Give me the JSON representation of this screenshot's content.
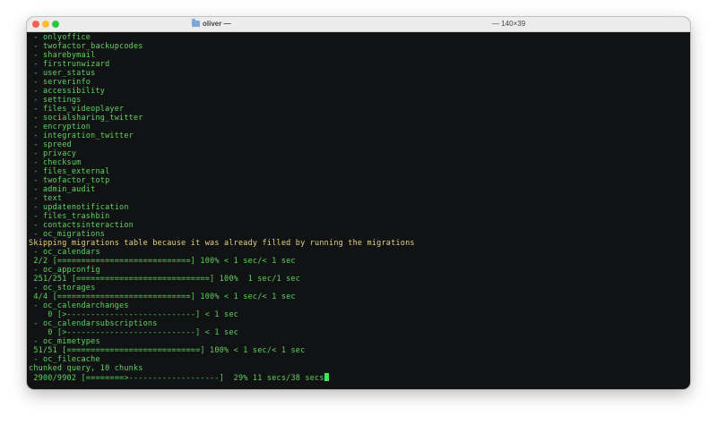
{
  "window": {
    "title_user": "oliver —",
    "title_size": "— 140×39",
    "colors": {
      "close": "#ff5f57",
      "minimize": "#febc2e",
      "zoom": "#28c840",
      "terminal_bg": "#111214",
      "text_green": "#5fd25f",
      "text_yellow": "#e6d27a",
      "cursor": "#41e35a"
    }
  },
  "terminal": {
    "lines": [
      {
        "text": " - onlyoffice",
        "color": "green"
      },
      {
        "text": " - twofactor_backupcodes",
        "color": "green"
      },
      {
        "text": " - sharebymail",
        "color": "green"
      },
      {
        "text": " - firstrunwizard",
        "color": "green"
      },
      {
        "text": " - user_status",
        "color": "green"
      },
      {
        "text": " - serverinfo",
        "color": "green"
      },
      {
        "text": " - accessibility",
        "color": "green"
      },
      {
        "text": " - settings",
        "color": "green"
      },
      {
        "text": " - files_videoplayer",
        "color": "green"
      },
      {
        "text": " - socialsharing_twitter",
        "color": "green"
      },
      {
        "text": " - encryption",
        "color": "green"
      },
      {
        "text": " - integration_twitter",
        "color": "green"
      },
      {
        "text": " - spreed",
        "color": "green"
      },
      {
        "text": " - privacy",
        "color": "green"
      },
      {
        "text": " - checksum",
        "color": "green"
      },
      {
        "text": " - files_external",
        "color": "green"
      },
      {
        "text": " - twofactor_totp",
        "color": "green"
      },
      {
        "text": " - admin_audit",
        "color": "green"
      },
      {
        "text": " - text",
        "color": "green"
      },
      {
        "text": " - updatenotification",
        "color": "green"
      },
      {
        "text": " - files_trashbin",
        "color": "green"
      },
      {
        "text": " - contactsinteraction",
        "color": "green"
      },
      {
        "text": " - oc_migrations",
        "color": "green"
      },
      {
        "text": "Skipping migrations table because it was already filled by running the migrations",
        "color": "yellow"
      },
      {
        "text": " - oc_calendars",
        "color": "green"
      },
      {
        "text": " 2/2 [============================] 100% < 1 sec/< 1 sec",
        "color": "green"
      },
      {
        "text": " - oc_appconfig",
        "color": "green"
      },
      {
        "text": " 251/251 [============================] 100%  1 sec/1 sec",
        "color": "green"
      },
      {
        "text": " - oc_storages",
        "color": "green"
      },
      {
        "text": " 4/4 [============================] 100% < 1 sec/< 1 sec",
        "color": "green"
      },
      {
        "text": " - oc_calendarchanges",
        "color": "green"
      },
      {
        "text": "    0 [>---------------------------] < 1 sec",
        "color": "green"
      },
      {
        "text": " - oc_calendarsubscriptions",
        "color": "green"
      },
      {
        "text": "    0 [>---------------------------] < 1 sec",
        "color": "green"
      },
      {
        "text": " - oc_mimetypes",
        "color": "green"
      },
      {
        "text": " 51/51 [============================] 100% < 1 sec/< 1 sec",
        "color": "green"
      },
      {
        "text": " - oc_filecache",
        "color": "green"
      },
      {
        "text": "chunked query, 10 chunks",
        "color": "green"
      },
      {
        "text": " 2900/9902 [========>-------------------]  29% 11 secs/38 secs",
        "color": "green",
        "cursor": true
      }
    ]
  }
}
